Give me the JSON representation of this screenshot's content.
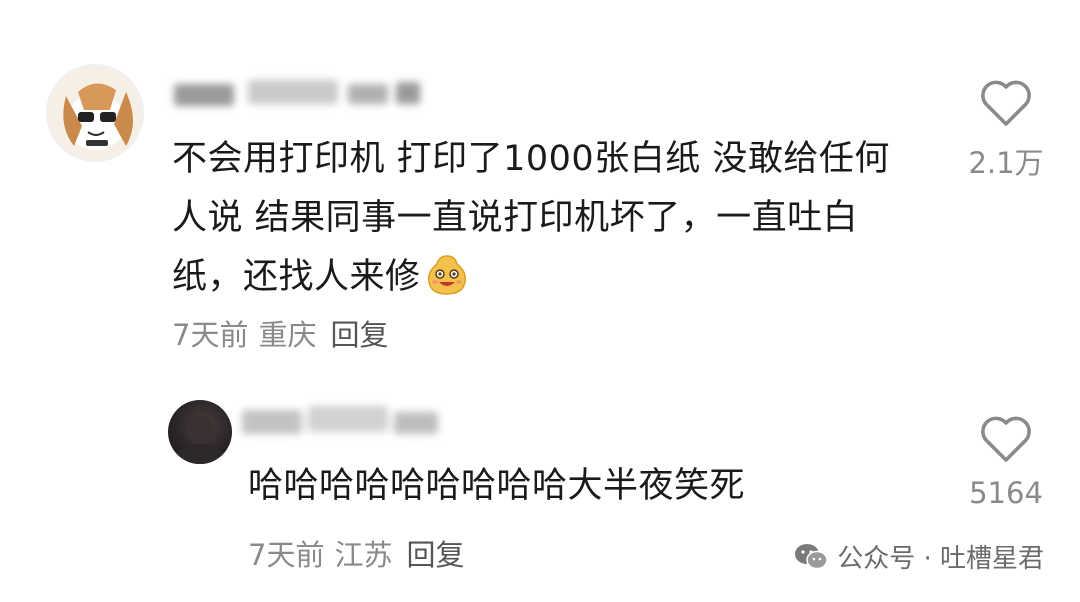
{
  "comments": [
    {
      "text": "不会用打印机 打印了1000张白纸 没敢给任何人说 结果同事一直说打印机坏了，一直吐白纸，还找人来修",
      "time": "7天前",
      "location": "重庆",
      "reply_label": "回复",
      "likes": "2.1万",
      "emoji": "smiling-face-emoji"
    },
    {
      "text": "哈哈哈哈哈哈哈哈哈大半夜笑死",
      "time": "7天前",
      "location": "江苏",
      "reply_label": "回复",
      "likes": "5164"
    }
  ],
  "watermark": {
    "text": "公众号 · 吐槽星君",
    "icon": "wechat-icon"
  },
  "colors": {
    "text": "#1a1a1a",
    "meta": "#8a8a8a",
    "heart": "#8a8a8a"
  }
}
